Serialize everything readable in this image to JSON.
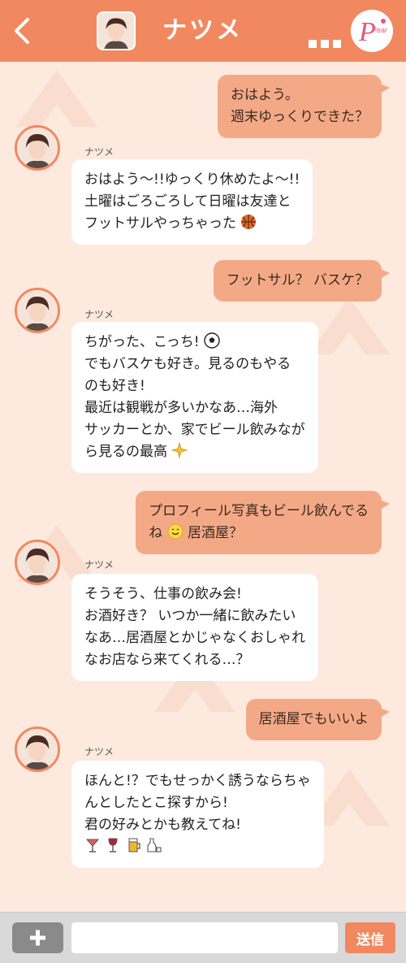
{
  "header": {
    "title": "ナツメ",
    "logo_text": "Pear"
  },
  "messages": [
    {
      "side": "right",
      "lines": [
        "おはよう。",
        "週末ゆっくりできた？"
      ]
    },
    {
      "side": "left",
      "sender": "ナツメ",
      "lines": [
        "おはよう～!!ゆっくり休めたよ～!!",
        "土曜はごろごろして日曜は友達と",
        "フットサルやっちゃった"
      ],
      "emoji": [
        "basketball-icon"
      ]
    },
    {
      "side": "right",
      "lines": [
        "フットサル？ バスケ？"
      ]
    },
    {
      "side": "left",
      "sender": "ナツメ",
      "lines": [
        "ちがった、こっち!",
        "でもバスケも好き。見るのもやる",
        "のも好き!",
        "最近は観戦が多いかなあ…海外",
        "サッカーとか、家でビール飲みなが",
        "ら見るの最高"
      ],
      "emoji": [
        "soccer-ball-icon",
        "sparkle-icon"
      ]
    },
    {
      "side": "right",
      "lines": [
        "プロフィール写真もビール飲んでる",
        "ね",
        "居酒屋？"
      ],
      "emoji": [
        "smile-icon"
      ]
    },
    {
      "side": "left",
      "sender": "ナツメ",
      "lines": [
        "そうそう、仕事の飲み会!",
        "お酒好き？ いつか一緒に飲みたい",
        "なあ…居酒屋とかじゃなくおしゃれ",
        "なお店なら来てくれる…？"
      ]
    },
    {
      "side": "right",
      "lines": [
        "居酒屋でもいいよ"
      ]
    },
    {
      "side": "left",
      "sender": "ナツメ",
      "lines": [
        "ほんと!？でもせっかく誘うならちゃ",
        "んとしたとこ探すから!",
        "君の好みとかも教えてね!"
      ],
      "emoji": [
        "cocktail-icon",
        "wine-icon",
        "beer-icon",
        "sake-icon"
      ]
    }
  ],
  "footer": {
    "input_value": "",
    "send_label": "送信"
  },
  "colors": {
    "accent": "#f2885f",
    "bubble_right": "#f4a986",
    "background": "#fde9dd"
  }
}
